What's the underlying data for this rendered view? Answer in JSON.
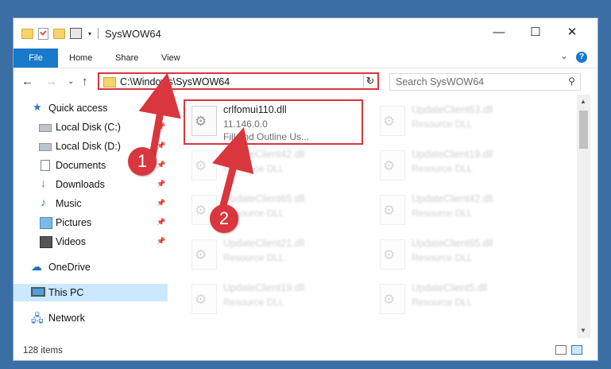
{
  "window": {
    "title": "SysWOW64",
    "controls": {
      "minimize": "—",
      "maximize": "☐",
      "close": "✕"
    }
  },
  "ribbon": {
    "tabs": [
      "File",
      "Home",
      "Share",
      "View"
    ],
    "help": "?",
    "expand": "⌄"
  },
  "nav": {
    "back": "←",
    "forward": "→",
    "recent": "⌄",
    "up": "↑",
    "address": "C:\\Windows\\SysWOW64",
    "address_dropdown": "⌄",
    "refresh": "↻",
    "search_placeholder": "Search SysWOW64",
    "search_icon": "⚲"
  },
  "sidebar": {
    "quick_access": "Quick access",
    "items": [
      {
        "label": "Local Disk (C:)",
        "icon": "disk-icon",
        "pinned": true
      },
      {
        "label": "Local Disk (D:)",
        "icon": "disk-icon",
        "pinned": true
      },
      {
        "label": "Documents",
        "icon": "documents-icon",
        "pinned": true
      },
      {
        "label": "Downloads",
        "icon": "download-icon",
        "pinned": true
      },
      {
        "label": "Music",
        "icon": "music-icon",
        "pinned": true
      },
      {
        "label": "Pictures",
        "icon": "pictures-icon",
        "pinned": true
      },
      {
        "label": "Videos",
        "icon": "videos-icon",
        "pinned": true
      }
    ],
    "onedrive": "OneDrive",
    "this_pc": "This PC",
    "network": "Network"
  },
  "files": {
    "featured": {
      "name": "crlfomui110.dll",
      "version": "11.146.0.0",
      "description": "Fill and Outline Us..."
    },
    "right_column": [
      {
        "name": "UpdateClient63.dll",
        "type": "Resource DLL"
      },
      {
        "name": "UpdateClient19.dll",
        "type": "Resource DLL"
      },
      {
        "name": "UpdateClient42.dll",
        "type": "Resource DLL"
      },
      {
        "name": "UpdateClient65.dll",
        "type": "Resource DLL"
      },
      {
        "name": "UpdateClient5.dll",
        "type": "Resource DLL"
      }
    ],
    "left_column": [
      {
        "name": "UpdateClient42.dll",
        "type": "Resource DLL"
      },
      {
        "name": "UpdateClient65.dll",
        "type": "Resource DLL"
      },
      {
        "name": "UpdateClient21.dll",
        "type": "Resource DLL"
      },
      {
        "name": "UpdateClient19.dll",
        "type": "Resource DLL"
      }
    ]
  },
  "status": {
    "count": "128 items"
  },
  "callouts": [
    "1",
    "2"
  ],
  "colors": {
    "accent": "#1979ca",
    "highlight": "#d9363e",
    "selected": "#cce8ff"
  }
}
